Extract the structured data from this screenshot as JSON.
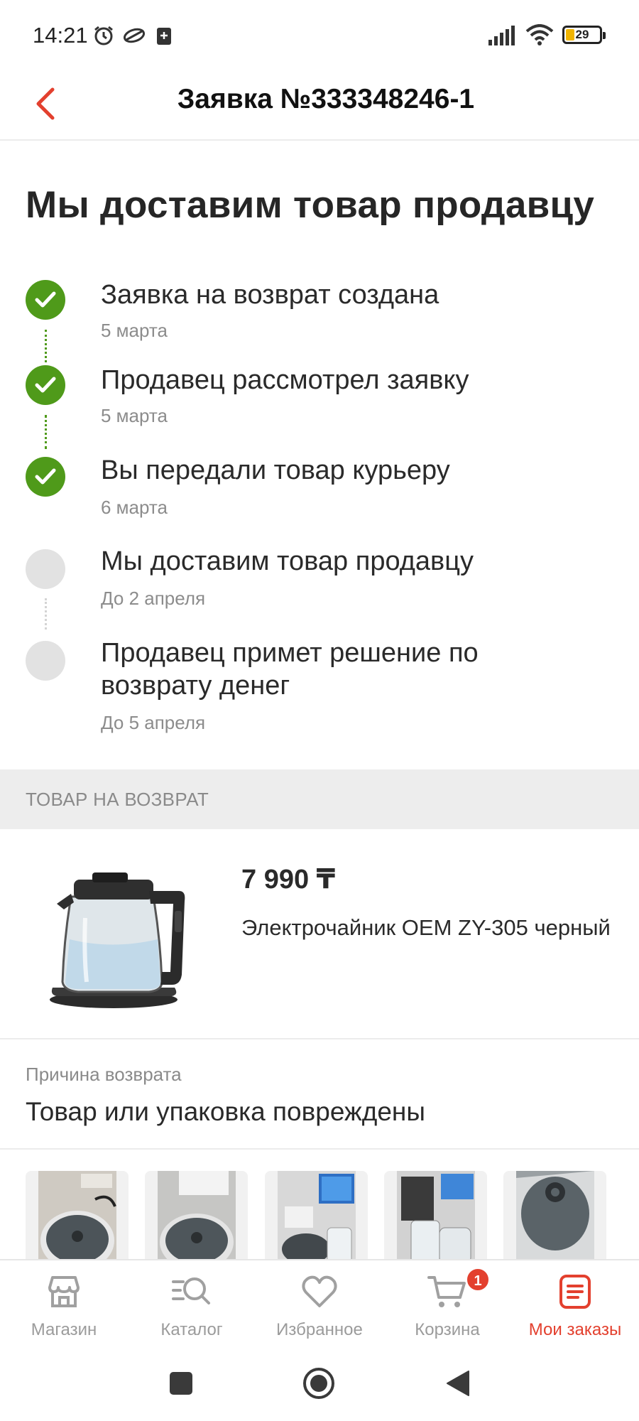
{
  "status_bar": {
    "time": "14:21",
    "battery": "29",
    "icons": [
      "alarm-icon",
      "cloud-icon",
      "sim-icon",
      "signal-icon",
      "wifi-icon",
      "battery-icon"
    ]
  },
  "header": {
    "title": "Заявка №333348246-1",
    "back_icon": "chevron-left-icon"
  },
  "page_title": "Мы доставим товар продавцу",
  "timeline": [
    {
      "label": "Заявка на возврат создана",
      "date": "5 марта",
      "status": "done"
    },
    {
      "label": "Продавец рассмотрел заявку",
      "date": "5 марта",
      "status": "done"
    },
    {
      "label": "Вы передали товар курьеру",
      "date": "6 марта",
      "status": "done"
    },
    {
      "label": "Мы доставим товар продавцу",
      "date": "До 2 апреля",
      "status": "pending"
    },
    {
      "label": "Продавец примет решение по возврату денег",
      "date": "До 5 апреля",
      "status": "pending"
    }
  ],
  "section": {
    "return_item_header": "ТОВАР НА ВОЗВРАТ"
  },
  "product": {
    "price": "7 990 ₸",
    "name": "Электрочайник OEM ZY-305 черный"
  },
  "reason": {
    "label": "Причина возврата",
    "value": "Товар или упаковка повреждены"
  },
  "photos_count": 5,
  "bottom_nav": [
    {
      "label": "Магазин",
      "icon": "store-icon",
      "active": false
    },
    {
      "label": "Каталог",
      "icon": "catalog-search-icon",
      "active": false
    },
    {
      "label": "Избранное",
      "icon": "heart-icon",
      "active": false
    },
    {
      "label": "Корзина",
      "icon": "cart-icon",
      "active": false,
      "badge": "1"
    },
    {
      "label": "Мои заказы",
      "icon": "orders-icon",
      "active": true
    }
  ],
  "colors": {
    "accent": "#e3402e",
    "done": "#4f9a1a",
    "pending": "#e2e2e2"
  }
}
